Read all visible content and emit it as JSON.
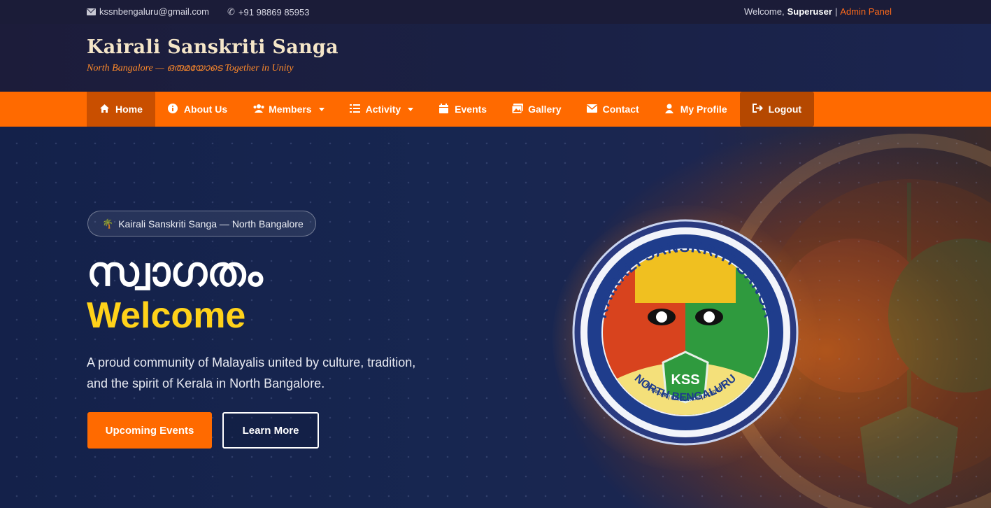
{
  "topbar": {
    "email": "kssnbengaluru@gmail.com",
    "phone": "+91 98869 85953",
    "welcome_prefix": "Welcome,",
    "username": "Superuser",
    "separator": "|",
    "admin_link": "Admin Panel"
  },
  "brand": {
    "title": "Kairali Sanskriti Sanga",
    "tagline": "North Bangalore — ഒരുമയോടെ Together in Unity"
  },
  "nav": {
    "items": [
      {
        "label": "Home",
        "icon": "home-icon",
        "active": true
      },
      {
        "label": "About Us",
        "icon": "info-icon"
      },
      {
        "label": "Members",
        "icon": "users-icon",
        "dropdown": true
      },
      {
        "label": "Activity",
        "icon": "list-icon",
        "dropdown": true
      },
      {
        "label": "Events",
        "icon": "calendar-icon"
      },
      {
        "label": "Gallery",
        "icon": "images-icon"
      },
      {
        "label": "Contact",
        "icon": "envelope-icon"
      },
      {
        "label": "My Profile",
        "icon": "user-icon"
      },
      {
        "label": "Logout",
        "icon": "sign-out-icon"
      }
    ]
  },
  "hero": {
    "pill": "Kairali Sanskriti Sanga — North Bangalore",
    "heading_malayalam": "സ്വാഗതം",
    "heading_english": "Welcome",
    "description": "A proud community of Malayalis united by culture, tradition, and the spirit of Kerala in North Bangalore.",
    "primary_button": "Upcoming Events",
    "secondary_button": "Learn More"
  },
  "emblem": {
    "arc_top": "KAIRALI SANSKRITI SANGA",
    "arc_bottom": "NORTH BENGALURU",
    "sub_arc": "NETWORK | INNOVATION | DIGIDRIVE",
    "shield": "KSS"
  },
  "colors": {
    "accent": "#ff6a00",
    "accent_dark": "#c94f00",
    "welcome_yellow": "#ffd21a",
    "navy": "#1b1c38"
  }
}
